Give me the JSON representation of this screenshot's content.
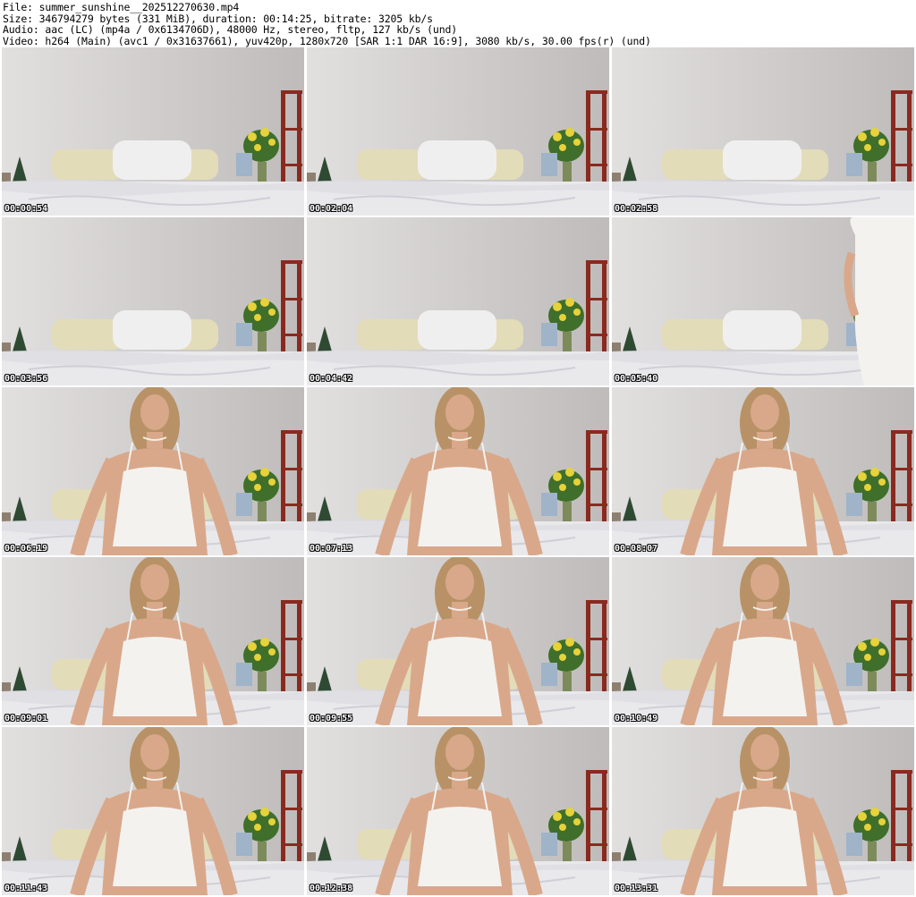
{
  "header": {
    "file_line": "File: summer_sunshine__202512270630.mp4",
    "size_line": "Size: 346794279 bytes (331 MiB), duration: 00:14:25, bitrate: 3205 kb/s",
    "audio_line": "Audio: aac (LC) (mp4a / 0x6134706D), 48000 Hz, stereo, fltp, 127 kb/s (und)",
    "video_line": "Video: h264 (Main) (avc1 / 0x31637661), yuv420p, 1280x720 [SAR 1:1 DAR 16:9], 3080 kb/s, 30.00 fps(r) (und)"
  },
  "colors": {
    "wall": "#d2cfce",
    "sheet": "#e9e9ec",
    "pillow_cream": "#e3dcb8",
    "pillow_white": "#f0efef",
    "shelf_red": "#8a2a1f",
    "flower_yellow": "#e6d23a",
    "leaf_green": "#3f6f2a",
    "dress_white": "#f4f2ef",
    "skin": "#d9a88a",
    "hair": "#b89266"
  },
  "thumbnails": [
    {
      "timestamp": "00:00:54",
      "person": "none"
    },
    {
      "timestamp": "00:02:04",
      "person": "none"
    },
    {
      "timestamp": "00:02:58",
      "person": "none"
    },
    {
      "timestamp": "00:03:56",
      "person": "none"
    },
    {
      "timestamp": "00:04:42",
      "person": "none"
    },
    {
      "timestamp": "00:05:40",
      "person": "edge"
    },
    {
      "timestamp": "00:06:19",
      "person": "center"
    },
    {
      "timestamp": "00:07:13",
      "person": "center"
    },
    {
      "timestamp": "00:08:07",
      "person": "center"
    },
    {
      "timestamp": "00:09:01",
      "person": "center"
    },
    {
      "timestamp": "00:09:55",
      "person": "center"
    },
    {
      "timestamp": "00:10:49",
      "person": "center"
    },
    {
      "timestamp": "00:11:43",
      "person": "center"
    },
    {
      "timestamp": "00:12:38",
      "person": "center"
    },
    {
      "timestamp": "00:13:31",
      "person": "center"
    }
  ]
}
